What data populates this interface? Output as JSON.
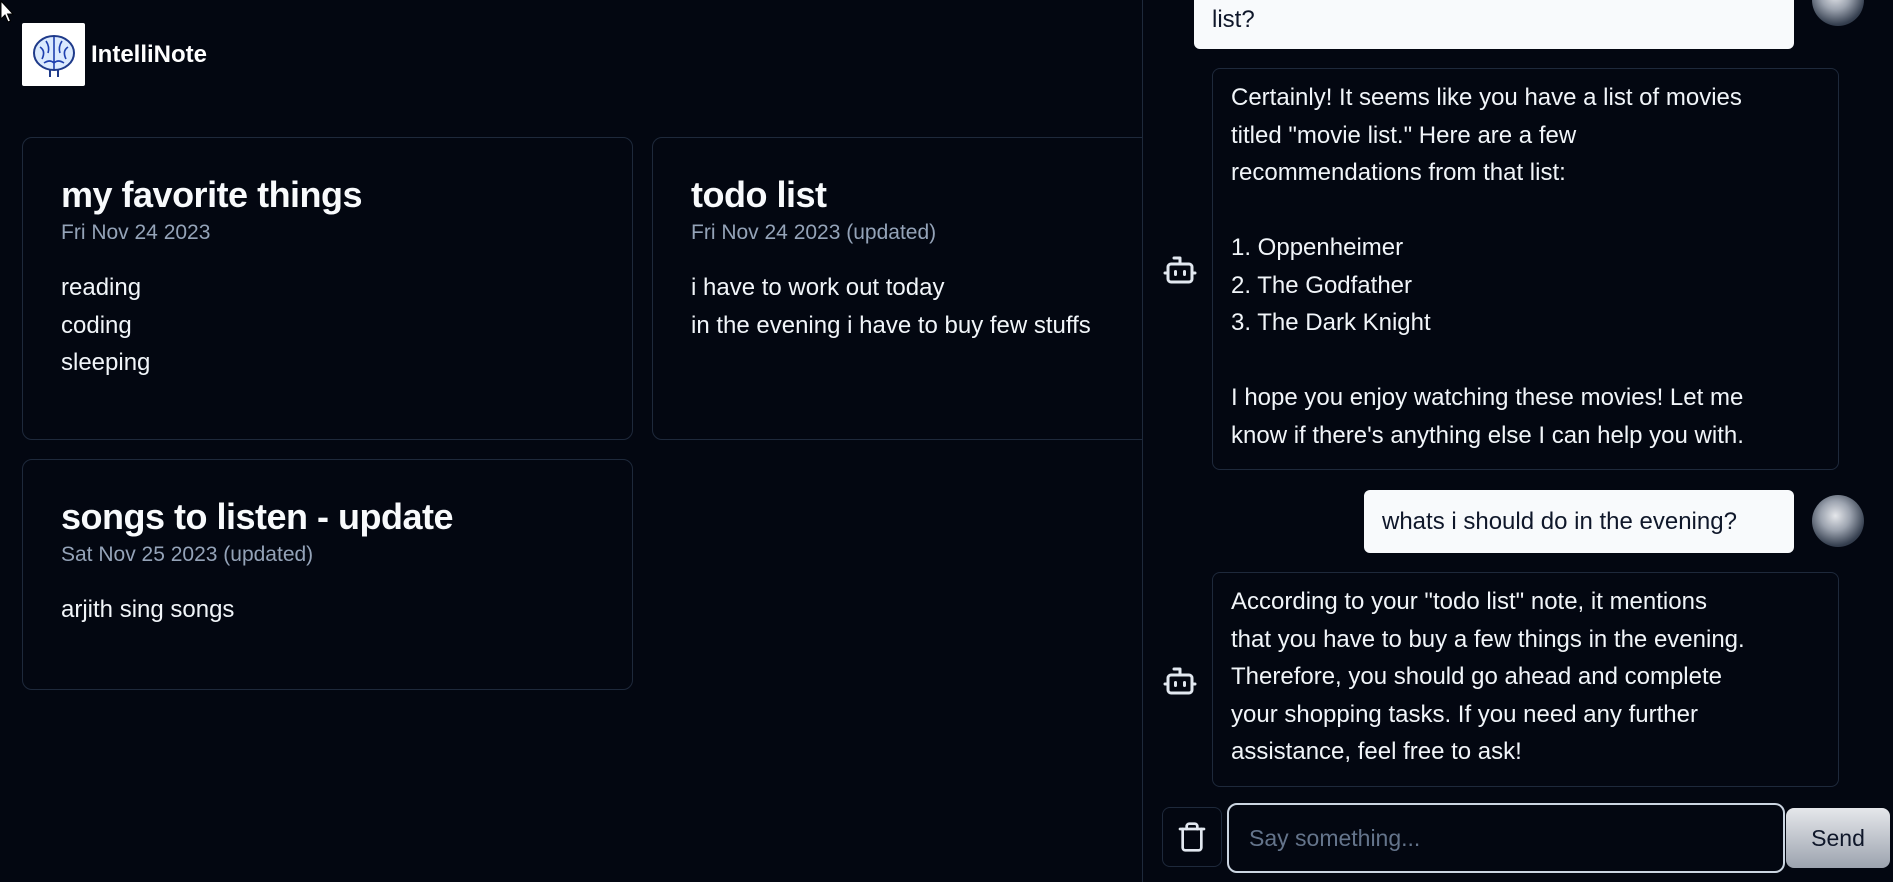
{
  "app": {
    "name": "IntelliNote"
  },
  "notes": [
    {
      "title": "my favorite things",
      "date": "Fri Nov 24 2023",
      "lines": [
        "reading",
        "coding",
        "sleeping"
      ]
    },
    {
      "title": "todo list",
      "date": "Fri Nov 24 2023 (updated)",
      "lines": [
        "i have to work out today",
        "in the evening i have to buy few stuffs"
      ]
    },
    {
      "title": "songs to listen - update",
      "date": "Sat Nov 25 2023 (updated)",
      "lines": [
        "arjith sing songs"
      ]
    }
  ],
  "chat": {
    "messages": [
      {
        "role": "user",
        "text": "list?"
      },
      {
        "role": "assistant",
        "text": "Certainly! It seems like you have a list of movies\ntitled \"movie list.\" Here are a few\nrecommendations from that list:\n\n1. Oppenheimer\n2. The Godfather\n3. The Dark Knight\n\nI hope you enjoy watching these movies! Let me\nknow if there's anything else I can help you with."
      },
      {
        "role": "user",
        "text": "whats i should do in the evening?"
      },
      {
        "role": "assistant",
        "text": "According to your \"todo list\" note, it mentions\nthat you have to buy a few things in the evening.\nTherefore, you should go ahead and complete\nyour shopping tasks. If you need any further\nassistance, feel free to ask!"
      }
    ],
    "input_placeholder": "Say something...",
    "send_label": "Send",
    "icons": {
      "assistant": "bot-icon",
      "clear": "trash-icon"
    }
  }
}
